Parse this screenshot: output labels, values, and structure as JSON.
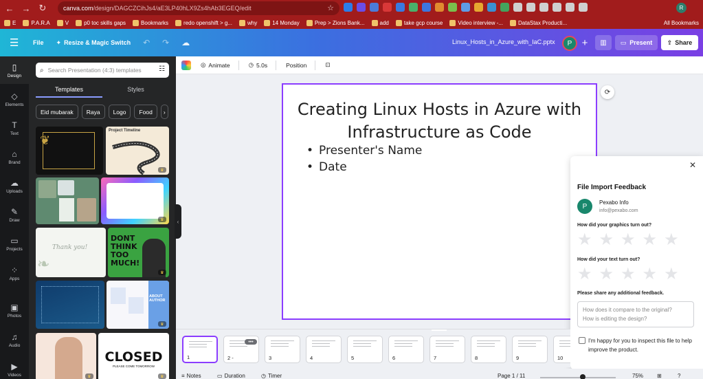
{
  "browser": {
    "url_host": "canva.com",
    "url_path": "/design/DAGCZCihJs4/aE3LP40hLX9Zs4hAb3EGEQ/edit",
    "avatar_letter": "R",
    "bookmarks": [
      "E",
      "P.A.R.A",
      "V",
      "p0 toc skills gaps",
      "Bookmarks",
      "redo openshift > g...",
      "why",
      "14 Monday",
      "Prep > Zions Bank...",
      "add",
      "take gcp course",
      "Video interview -...",
      "DataStax Producti..."
    ],
    "all_bookmarks": "All Bookmarks"
  },
  "header": {
    "file_label": "File",
    "resize_label": "Resize & Magic Switch",
    "doc_name": "Linux_Hosts_in_Azure_with_IaC.pptx",
    "avatar_letter": "P",
    "present_label": "Present",
    "share_label": "Share"
  },
  "rail": {
    "items": [
      {
        "label": "Design",
        "icon": "▯"
      },
      {
        "label": "Elements",
        "icon": "◇"
      },
      {
        "label": "Text",
        "icon": "T"
      },
      {
        "label": "Brand",
        "icon": "⌂"
      },
      {
        "label": "Uploads",
        "icon": "☁"
      },
      {
        "label": "Draw",
        "icon": "✎"
      },
      {
        "label": "Projects",
        "icon": "▭"
      },
      {
        "label": "Apps",
        "icon": "⁘"
      },
      {
        "label": "Photos",
        "icon": "▣"
      },
      {
        "label": "Audio",
        "icon": "♫"
      },
      {
        "label": "Videos",
        "icon": "▶"
      }
    ]
  },
  "panel": {
    "search_placeholder": "Search Presentation (4:3) templates",
    "tabs": [
      "Templates",
      "Styles"
    ],
    "chips": [
      "Eid mubarak",
      "Raya",
      "Logo",
      "Food"
    ],
    "thumb_texts": {
      "timeline": "Project Timeline",
      "thanks": "Thank you!",
      "dont_think": "DONT THINK TOO MUCH!",
      "closed": "CLOSED",
      "closed_sub": "PLEASE COME TOMORROW",
      "about": "ABOUT AUTHOR"
    }
  },
  "toolbar": {
    "animate_label": "Animate",
    "duration_label": "5.0s",
    "position_label": "Position"
  },
  "slide": {
    "title_line1": "Creating Linux Hosts in Azure with",
    "title_line2": "Infrastructure as Code",
    "bullets": [
      "Presenter's Name",
      "Date"
    ]
  },
  "feedback": {
    "title": "File Import Feedback",
    "sender_name": "Pexabo Info",
    "sender_email": "info@pexabo.com",
    "avatar_letter": "P",
    "q1": "How did your graphics turn out?",
    "q2": "How did your text turn out?",
    "q3": "Please share any additional feedback.",
    "textarea_placeholder_1": "How does it compare to the original?",
    "textarea_placeholder_2": "How is editing the design?",
    "checkbox_label": "I'm happy for you to inspect this file to help improve the product.",
    "graphics_rating": 0,
    "text_rating": 0
  },
  "pages": {
    "numbers": [
      "1",
      "2 -",
      "3",
      "4",
      "5",
      "6",
      "7",
      "8",
      "9",
      "10"
    ],
    "current": 1
  },
  "footer": {
    "notes_label": "Notes",
    "duration_label": "Duration",
    "timer_label": "Timer",
    "page_indicator": "Page 1 / 11",
    "zoom": "75%"
  }
}
